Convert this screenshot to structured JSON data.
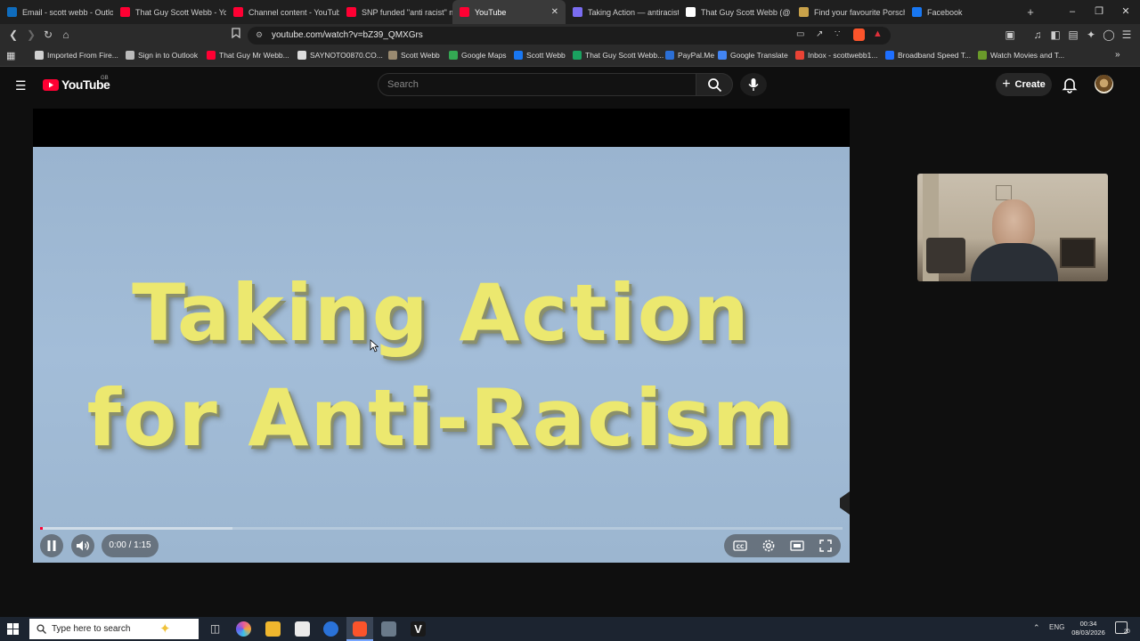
{
  "browser": {
    "tabs": [
      {
        "label": "Email - scott webb - Outlo",
        "icon": "outlook-icon",
        "color": "#0f6cbd"
      },
      {
        "label": "That Guy Scott Webb - Yo",
        "icon": "youtube-icon",
        "color": "#ff0033"
      },
      {
        "label": "Channel content - YouTub",
        "icon": "youtube-studio-icon",
        "color": "#ff0033"
      },
      {
        "label": "SNP funded \"anti racist\" m",
        "icon": "youtube-icon",
        "color": "#ff0033"
      },
      {
        "label": "YouTube",
        "icon": "youtube-icon",
        "color": "#ff0033",
        "active": true
      },
      {
        "label": "Taking Action — antiracist",
        "icon": "globe-icon",
        "color": "#7a6cf0"
      },
      {
        "label": "That Guy Scott Webb (@",
        "icon": "x-icon",
        "color": "#ffffff"
      },
      {
        "label": "Find your favourite Porsch",
        "icon": "porsche-icon",
        "color": "#c9a24a"
      },
      {
        "label": "Facebook",
        "icon": "facebook-icon",
        "color": "#1877f2"
      }
    ],
    "new_tab": "+",
    "url": "youtube.com/watch?v=bZ39_QMXGrs",
    "bookmarks": [
      {
        "label": "Imported From Fire...",
        "icon": "folder-icon",
        "color": "#d0d0d0"
      },
      {
        "label": "Sign in to Outlook",
        "icon": "globe-icon",
        "color": "#bbbbbb"
      },
      {
        "label": "That Guy Mr Webb...",
        "icon": "youtube-icon",
        "color": "#ff0033"
      },
      {
        "label": "SAYNOTO0870.CO...",
        "icon": "globe-icon",
        "color": "#dddddd"
      },
      {
        "label": "Scott Webb",
        "icon": "avatar-icon",
        "color": "#9a8a70"
      },
      {
        "label": "Google Maps",
        "icon": "maps-icon",
        "color": "#34a853"
      },
      {
        "label": "Scott Webb",
        "icon": "facebook-icon",
        "color": "#1877f2"
      },
      {
        "label": "That Guy Scott Webb...",
        "icon": "generic-icon",
        "color": "#1aa260"
      },
      {
        "label": "PayPal.Me",
        "icon": "paypal-icon",
        "color": "#2b6fd6"
      },
      {
        "label": "Google Translate",
        "icon": "translate-icon",
        "color": "#4285f4"
      },
      {
        "label": "Inbox - scottwebb1...",
        "icon": "gmail-icon",
        "color": "#ea4335"
      },
      {
        "label": "Broadband Speed T...",
        "icon": "speed-icon",
        "color": "#1e6fff"
      },
      {
        "label": "Watch Movies and T...",
        "icon": "movies-icon",
        "color": "#6a9a2a"
      }
    ]
  },
  "youtube": {
    "logo": "YouTube",
    "region": "GB",
    "search_placeholder": "Search",
    "create_label": "Create"
  },
  "video": {
    "title_line1": "Taking Action",
    "title_line2": "for Anti-Racism",
    "time": "0:00 / 1:15",
    "progress_fraction": 0.0,
    "buffered_fraction": 0.24
  },
  "taskbar": {
    "search_placeholder": "Type here to search",
    "language": "ENG",
    "time": "00:34",
    "date": "08/03/2026",
    "notifications": "20"
  }
}
